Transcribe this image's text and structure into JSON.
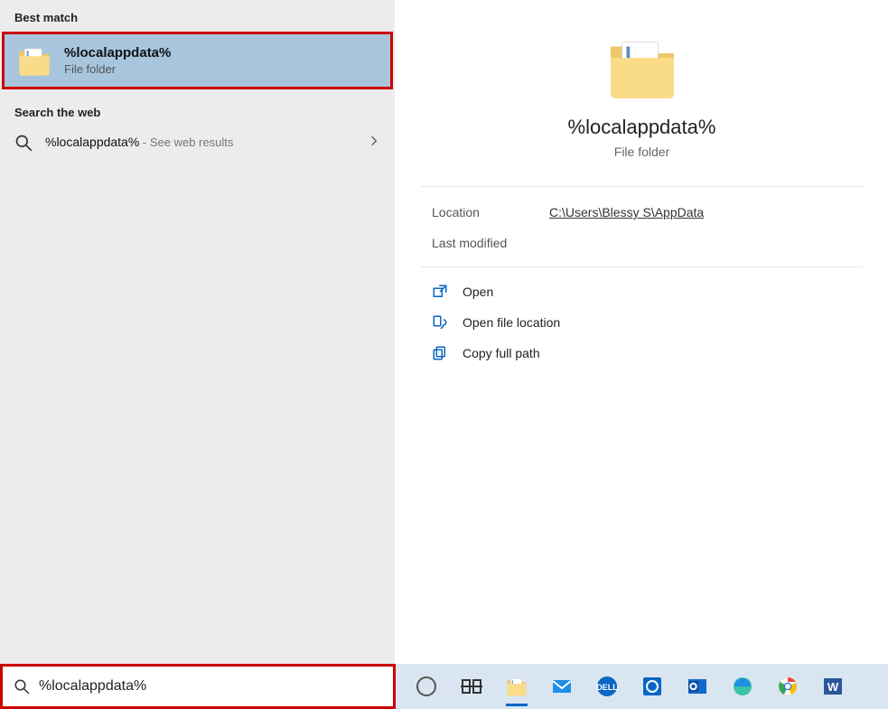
{
  "left": {
    "best_match_header": "Best match",
    "result": {
      "title": "%localappdata%",
      "subtitle": "File folder"
    },
    "web_header": "Search the web",
    "web_result": {
      "text": "%localappdata%",
      "hint": " - See web results"
    }
  },
  "right": {
    "title": "%localappdata%",
    "subtitle": "File folder",
    "props": {
      "location_label": "Location",
      "location_value": "C:\\Users\\Blessy S\\AppData",
      "modified_label": "Last modified",
      "modified_value": ""
    },
    "actions": {
      "open": "Open",
      "open_location": "Open file location",
      "copy_path": "Copy full path"
    }
  },
  "search": {
    "value": "%localappdata%"
  },
  "taskbar": {
    "items": [
      {
        "name": "cortana",
        "active": false
      },
      {
        "name": "task-view",
        "active": false
      },
      {
        "name": "file-explorer",
        "active": true
      },
      {
        "name": "mail",
        "active": false
      },
      {
        "name": "dell",
        "active": false
      },
      {
        "name": "dell-update",
        "active": false
      },
      {
        "name": "outlook",
        "active": false
      },
      {
        "name": "edge",
        "active": false
      },
      {
        "name": "chrome",
        "active": false
      },
      {
        "name": "word",
        "active": false
      }
    ]
  }
}
